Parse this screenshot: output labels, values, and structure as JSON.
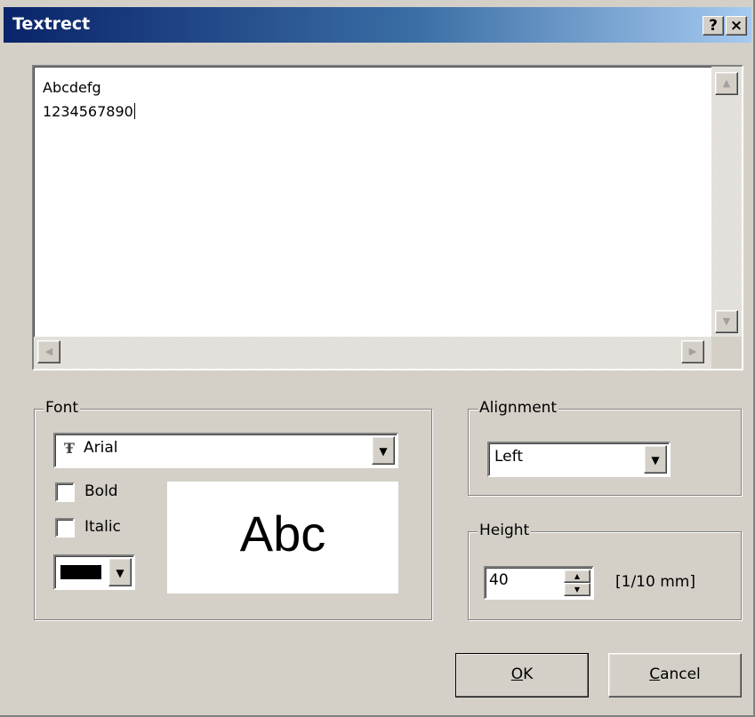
{
  "window": {
    "title": "Textrect",
    "help_label": "?",
    "close_label": "×"
  },
  "editor": {
    "lines": [
      "Abcdefg",
      "1234567890"
    ]
  },
  "font_group": {
    "legend": "Font",
    "font_name": "Arial",
    "font_icon": "truetype-font-icon",
    "bold_label": "Bold",
    "bold_checked": false,
    "italic_label": "Italic",
    "italic_checked": false,
    "color": "#000000",
    "preview_text": "Abc"
  },
  "alignment_group": {
    "legend": "Alignment",
    "value": "Left"
  },
  "height_group": {
    "legend": "Height",
    "value": "40",
    "unit": "[1/10 mm]"
  },
  "buttons": {
    "ok_hotkey": "O",
    "ok_rest": "K",
    "cancel_hotkey": "C",
    "cancel_rest": "ancel"
  }
}
